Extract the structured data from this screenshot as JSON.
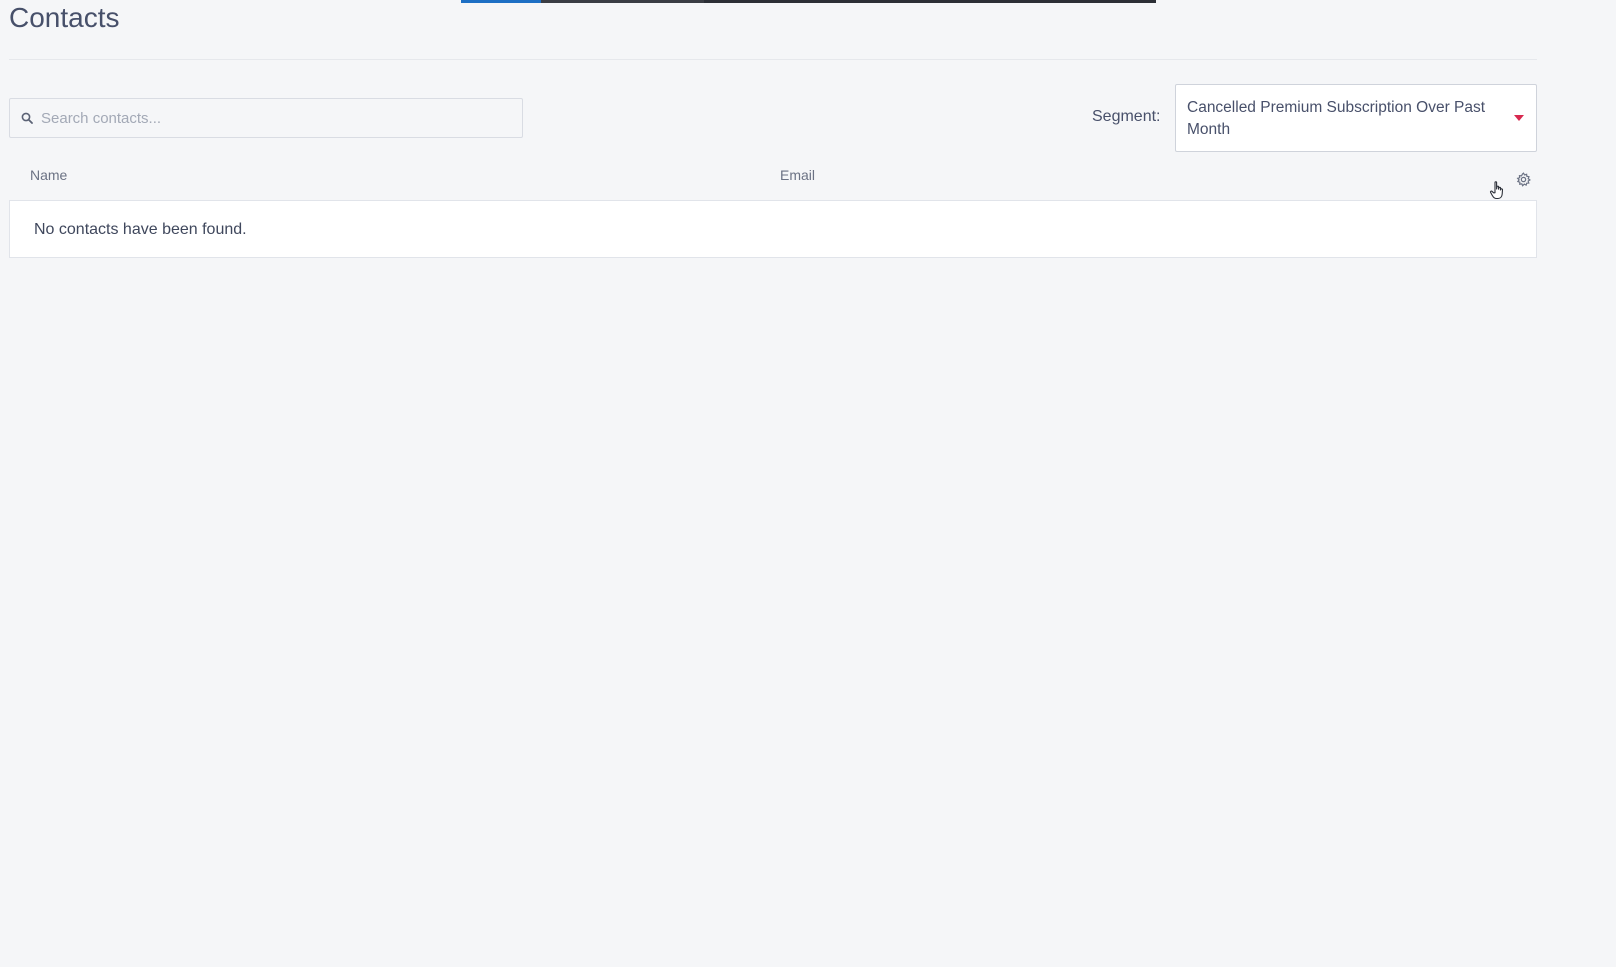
{
  "page": {
    "title": "Contacts"
  },
  "search": {
    "placeholder": "Search contacts...",
    "value": ""
  },
  "segment": {
    "label": "Segment:",
    "selected": "Cancelled Premium Subscription Over Past Month"
  },
  "table": {
    "columns": [
      "Name",
      "Email"
    ],
    "empty_message": "No contacts have been found."
  },
  "icons": {
    "search": "search-icon",
    "settings": "gear-icon",
    "caret": "caret-down-icon",
    "cursor": "hand-pointer-icon"
  },
  "colors": {
    "accent": "#d8294f",
    "progress": "#1d6fc4",
    "text": "#48506a",
    "background": "#f5f6f8"
  }
}
